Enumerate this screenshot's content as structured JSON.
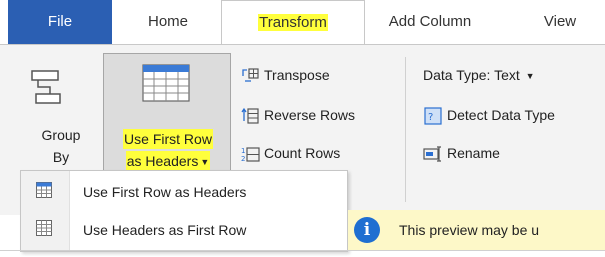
{
  "tabs": {
    "file": "File",
    "home": "Home",
    "transform": "Transform",
    "add_column": "Add Column",
    "view": "View"
  },
  "ribbon": {
    "group_by": {
      "line1": "Group",
      "line2": "By"
    },
    "use_first_row": {
      "line1": "Use First Row",
      "line2": "as Headers"
    },
    "transpose": "Transpose",
    "reverse_rows": "Reverse Rows",
    "count_rows": "Count Rows",
    "data_type": "Data Type: Text",
    "detect_data_type": "Detect Data Type",
    "rename": "Rename"
  },
  "menu": {
    "items": [
      {
        "label": "Use First Row as Headers",
        "icon": "table-header-icon"
      },
      {
        "label": "Use Headers as First Row",
        "icon": "table-icon"
      }
    ]
  },
  "infobar": {
    "text": "This preview may be u"
  },
  "colors": {
    "file_tab": "#2b5fb3",
    "highlight": "#ffff3c",
    "info_icon": "#1f6fd1",
    "infobar_bg": "#fdf8c8"
  }
}
